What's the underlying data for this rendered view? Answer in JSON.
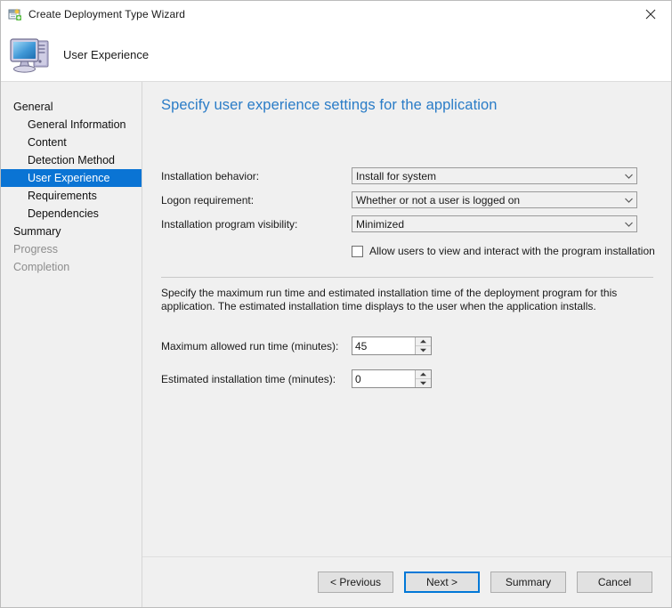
{
  "window": {
    "title": "Create Deployment Type Wizard",
    "title_icon": "wizard-window-icon",
    "close_icon": "close-icon"
  },
  "header": {
    "title": "User Experience",
    "icon": "computer-icon"
  },
  "sidebar": {
    "items": [
      {
        "label": "General",
        "level": "parent",
        "state": "normal"
      },
      {
        "label": "General Information",
        "level": "child",
        "state": "normal"
      },
      {
        "label": "Content",
        "level": "child",
        "state": "normal"
      },
      {
        "label": "Detection Method",
        "level": "child",
        "state": "normal"
      },
      {
        "label": "User Experience",
        "level": "child",
        "state": "selected"
      },
      {
        "label": "Requirements",
        "level": "child",
        "state": "normal"
      },
      {
        "label": "Dependencies",
        "level": "child",
        "state": "normal"
      },
      {
        "label": "Summary",
        "level": "parent",
        "state": "normal"
      },
      {
        "label": "Progress",
        "level": "parent",
        "state": "disabled"
      },
      {
        "label": "Completion",
        "level": "parent",
        "state": "disabled"
      }
    ]
  },
  "main": {
    "heading": "Specify user experience settings for the application",
    "fields": {
      "installation_behavior": {
        "label": "Installation behavior:",
        "value": "Install for system",
        "arrow_icon": "chevron-down-icon"
      },
      "logon_requirement": {
        "label": "Logon requirement:",
        "value": "Whether or not a user is logged on",
        "arrow_icon": "chevron-down-icon"
      },
      "installation_program_visibility": {
        "label": "Installation program visibility:",
        "value": "Minimized",
        "arrow_icon": "chevron-down-icon"
      },
      "allow_users_interact": {
        "label": "Allow users to view and interact with the program installation",
        "checked": false
      }
    },
    "section_description": "Specify the maximum run time and estimated installation time of the deployment program for this application. The estimated installation time displays to the user when the application installs.",
    "spinners": {
      "max_run_time": {
        "label": "Maximum allowed run time (minutes):",
        "value": "45"
      },
      "estimated_install_time": {
        "label": "Estimated installation time (minutes):",
        "value": "0"
      }
    }
  },
  "footer": {
    "buttons": [
      {
        "label": "< Previous",
        "focused": false
      },
      {
        "label": "Next >",
        "focused": true
      },
      {
        "label": "Summary",
        "focused": false
      },
      {
        "label": "Cancel",
        "focused": false
      }
    ]
  },
  "colors": {
    "accent_blue": "#0a74d4",
    "heading_blue": "#2a7cc7",
    "focus_blue": "#0078d7",
    "window_bg": "#f0f0f0",
    "disabled_text": "#8d8d8d"
  }
}
